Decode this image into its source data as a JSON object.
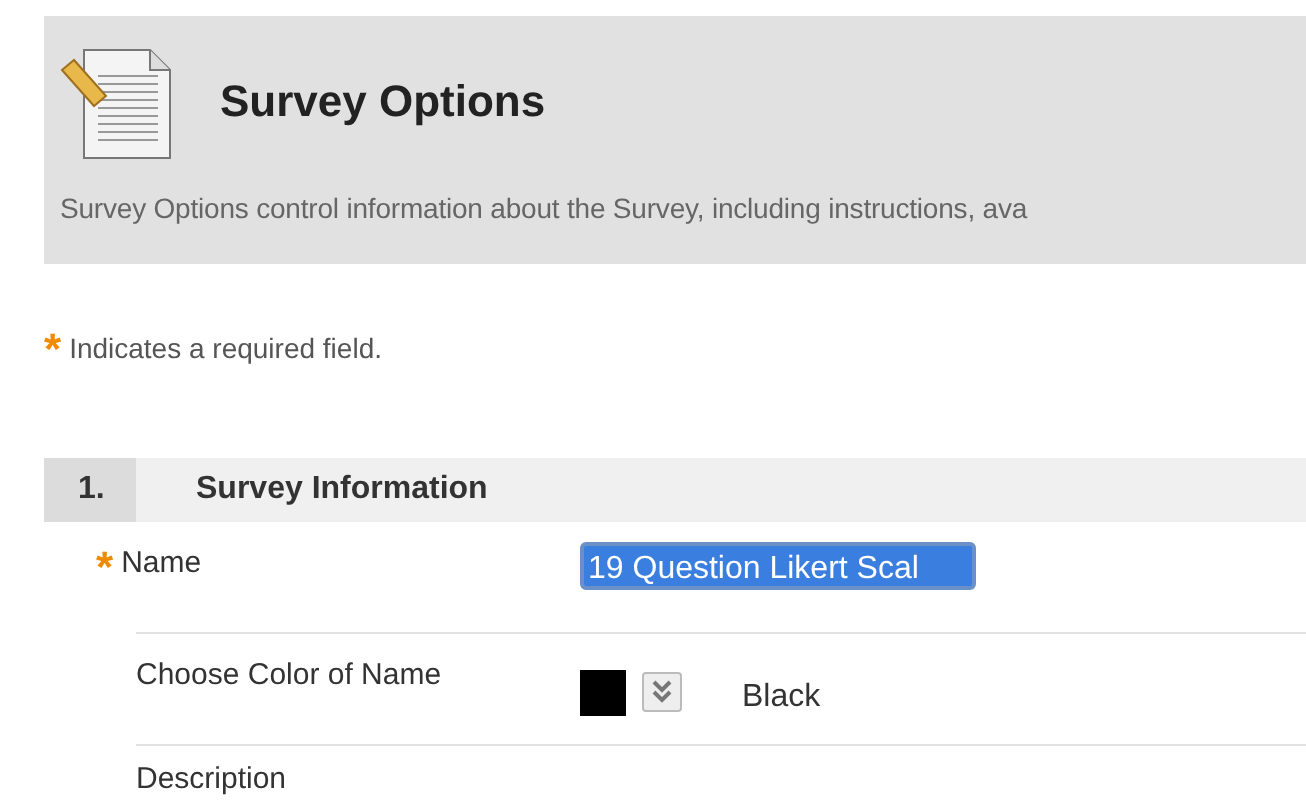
{
  "header": {
    "title": "Survey Options",
    "description": "Survey Options control information about the Survey, including instructions, ava"
  },
  "required_note": {
    "marker": "*",
    "text": "Indicates a required field."
  },
  "section": {
    "number": "1.",
    "title": "Survey Information",
    "fields": [
      {
        "kind": "text",
        "label": "Name",
        "required": true,
        "value": "19 Question Likert Scal"
      },
      {
        "kind": "color",
        "label": "Choose Color of Name",
        "required": false,
        "color": "#000000",
        "value": "Black"
      },
      {
        "kind": "label",
        "label": "Description",
        "required": false
      }
    ]
  }
}
